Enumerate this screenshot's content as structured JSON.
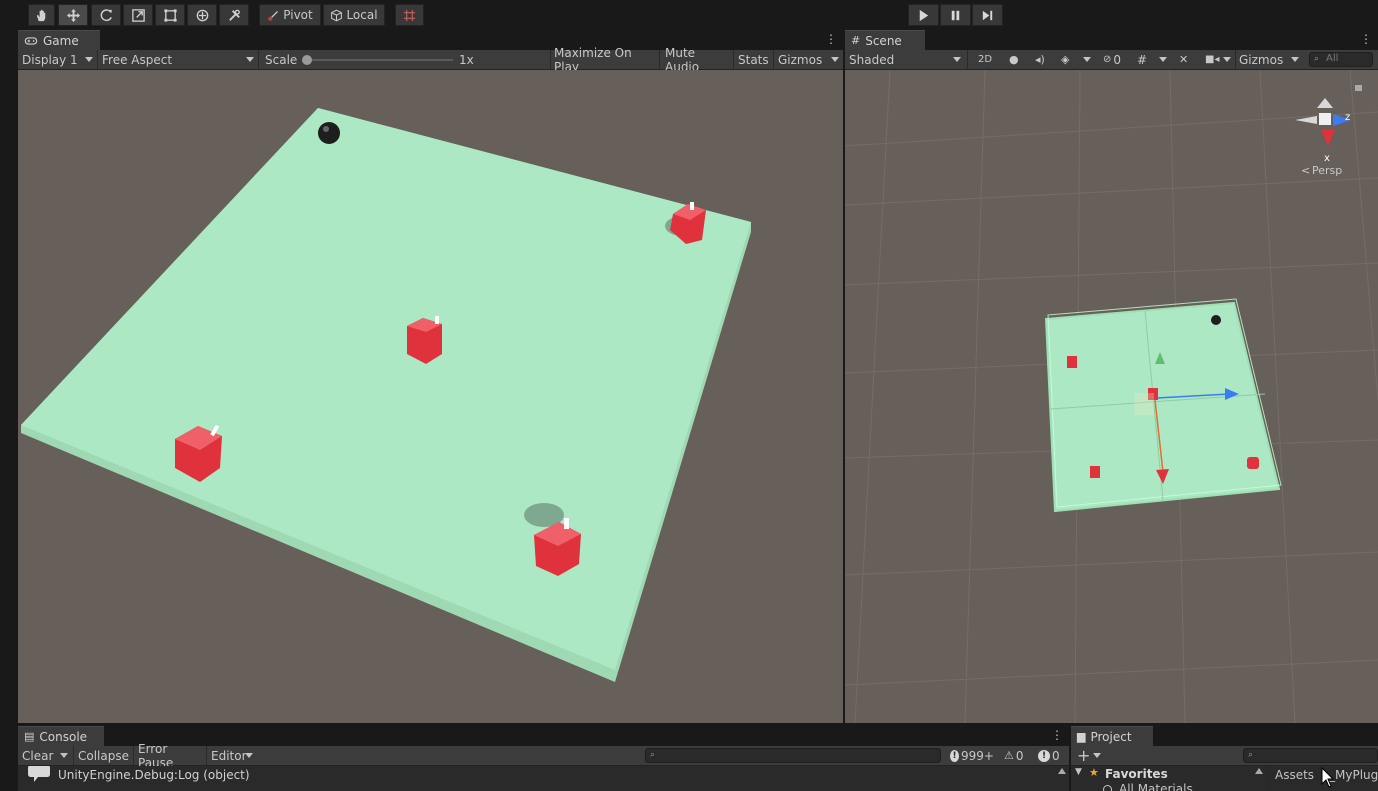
{
  "toolbar": {
    "tools": [
      "hand-tool",
      "move-tool",
      "rotate-tool",
      "scale-tool",
      "rect-tool",
      "transform-tool",
      "custom-tool"
    ],
    "pivot_label": "Pivot",
    "local_label": "Local"
  },
  "game": {
    "tab_label": "Game",
    "display": "Display 1",
    "aspect": "Free Aspect",
    "scale_label": "Scale",
    "scale_value": "1x",
    "maximize": "Maximize On Play",
    "mute": "Mute Audio",
    "stats": "Stats",
    "gizmos": "Gizmos"
  },
  "scene": {
    "tab_label": "Scene",
    "shading": "Shaded",
    "mode_2d": "2D",
    "hidden_count": "0",
    "gizmos": "Gizmos",
    "search_placeholder": "All",
    "persp_label": "Persp",
    "axis_z": "z",
    "axis_x": "x"
  },
  "console": {
    "tab_label": "Console",
    "clear": "Clear",
    "collapse": "Collapse",
    "error_pause": "Error Pause",
    "editor": "Editor",
    "log_count": "999+",
    "warn_count": "0",
    "error_count": "0",
    "entries": [
      "UnityEngine.Debug:Log (object)"
    ]
  },
  "project": {
    "tab_label": "Project",
    "favorites": "Favorites",
    "all_materials": "All Materials",
    "breadcrumb_assets": "Assets",
    "breadcrumb_folder": "_MyPlug"
  },
  "colors": {
    "ground": "#ace8c3",
    "cube": "#e0323c",
    "viewport_bg": "#675f59"
  }
}
